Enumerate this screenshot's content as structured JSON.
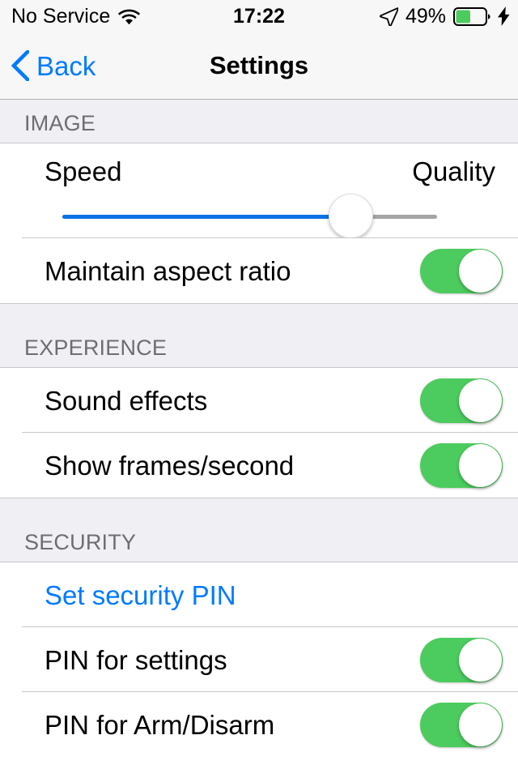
{
  "status_bar": {
    "carrier": "No Service",
    "wifi_icon": "wifi-icon",
    "time": "17:22",
    "location_icon": "location-arrow-icon",
    "battery_percent": "49%",
    "battery_level": 49,
    "battery_icon": "battery-icon",
    "charging_icon": "lightning-bolt-icon"
  },
  "nav_bar": {
    "back_icon": "chevron-left-icon",
    "back_label": "Back",
    "title": "Settings"
  },
  "colors": {
    "accent_blue": "#007AFF",
    "slider_blue": "#0B72E7",
    "toggle_green": "#4CCB5E",
    "group_background": "#EFEFF4",
    "separator": "#C8C7CC",
    "header_text": "#6D6D72"
  },
  "sections": [
    {
      "header": "IMAGE",
      "rows": [
        {
          "type": "slider",
          "name": "image-quality-slider",
          "left_label": "Speed",
          "right_label": "Quality",
          "value_percent": 77
        },
        {
          "type": "toggle",
          "name": "maintain-aspect-ratio",
          "label": "Maintain aspect ratio",
          "value": "on"
        }
      ]
    },
    {
      "header": "EXPERIENCE",
      "rows": [
        {
          "type": "toggle",
          "name": "sound-effects",
          "label": "Sound effects",
          "value": "on"
        },
        {
          "type": "toggle",
          "name": "show-frames-per-second",
          "label": "Show frames/second",
          "value": "on"
        }
      ]
    },
    {
      "header": "SECURITY",
      "rows": [
        {
          "type": "link",
          "name": "set-security-pin",
          "label": "Set security PIN"
        },
        {
          "type": "toggle",
          "name": "pin-for-settings",
          "label": "PIN for settings",
          "value": "on"
        },
        {
          "type": "toggle",
          "name": "pin-for-arm-disarm",
          "label": "PIN for Arm/Disarm",
          "value": "on"
        }
      ]
    }
  ]
}
